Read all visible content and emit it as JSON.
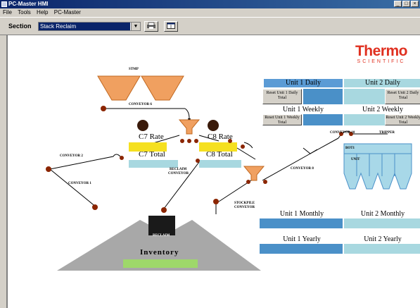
{
  "window": {
    "title": "PC-Master HMI",
    "buttons": [
      "_",
      "□",
      "×"
    ]
  },
  "menu": [
    "File",
    "Tools",
    "Help",
    "PC-Master"
  ],
  "toolbar": {
    "section_label": "Section",
    "section_value": "Stack Reclaim",
    "combo_arrow": "▼",
    "print_icon": "print-icon",
    "window_icon": "window-icon"
  },
  "logo": {
    "line1": "Thermo",
    "line2": "SCIENTIFIC",
    "color": "#e03020"
  },
  "labels": {
    "stmp": "STMP",
    "conveyor6": "CONVEYOR 6",
    "conveyor2": "CONVEYOR 2",
    "conveyor1": "CONVEYOR 1",
    "reclaim_conveyor_1": "RECLAIM",
    "reclaim_conveyor_2": "CONVEYOR",
    "stockpile_conveyor_1": "STOCKPILE",
    "stockpile_conveyor_2": "CONVEYOR",
    "conveyor8": "CONVEYOR 8",
    "conveyor10": "CONVEYOR 10",
    "tripper": "TRIPPER",
    "bin_label_1": "BOT1",
    "bin_label_2": "UNIT",
    "reclaim": "RECLAIM",
    "inventory": "Inventory"
  },
  "rates": {
    "c7_rate": "C7 Rate",
    "c8_rate": "C8 Rate",
    "c7_total": "C7 Total",
    "c8_total": "C8 Total"
  },
  "totals": {
    "unit1_daily": "Unit 1 Daily",
    "unit2_daily": "Unit 2 Daily",
    "unit1_weekly": "Unit 1 Weekly",
    "unit2_weekly": "Unit 2 Weekly",
    "unit1_monthly": "Unit 1 Monthly",
    "unit2_monthly": "Unit 2 Monthly",
    "unit1_yearly": "Unit 1 Yearly",
    "unit2_yearly": "Unit 2 Yearly",
    "reset_u1_daily": "Reset Unit 1 Daily Total",
    "reset_u2_daily": "Reset Unit 2 Daily Total",
    "reset_u1_weekly": "Reset Unit 1 Weekly Total",
    "reset_u2_weekly": "Reset Unit 2 Weekly Total"
  },
  "colors": {
    "header_blue": "#5b9bd5",
    "value_blue": "#4a90c8",
    "value_cyan": "#a8d8e0",
    "rate_yellow": "#f5e020",
    "hopper_orange": "#f0a060",
    "pile_gray": "#a8a8a8",
    "inventory_green": "#9ed86a",
    "motor_red": "#8b2500"
  }
}
